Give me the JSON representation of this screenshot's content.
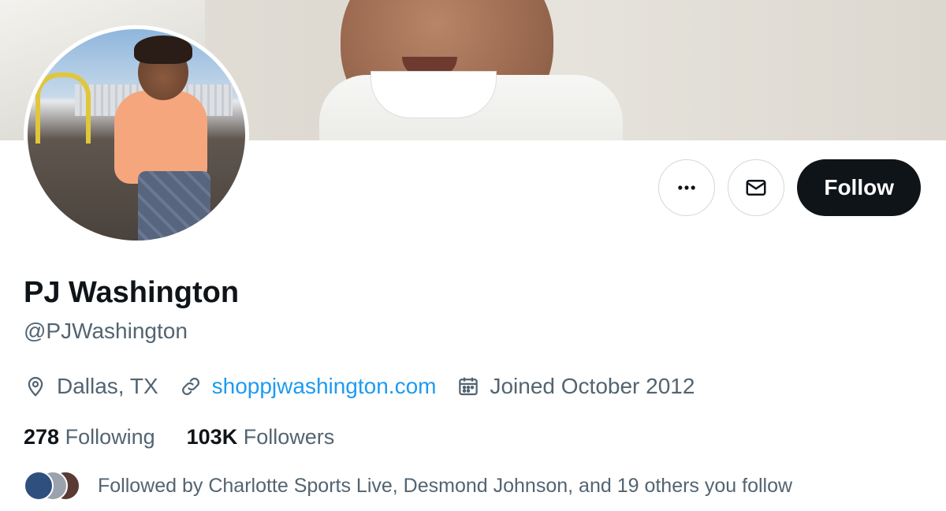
{
  "profile": {
    "name": "PJ Washington",
    "handle": "@PJWashington",
    "location": "Dallas, TX",
    "website": "shoppjwashington.com",
    "joined": "Joined October 2012"
  },
  "actions": {
    "more_icon": "more-horizontal-icon",
    "message_icon": "envelope-icon",
    "follow_label": "Follow"
  },
  "stats": {
    "following_count": "278",
    "following_label": "Following",
    "followers_count": "103K",
    "followers_label": "Followers"
  },
  "followed_by": {
    "text": "Followed by Charlotte Sports Live, Desmond Johnson, and 19 others you follow",
    "avatar_colors": [
      "#2f4f7f",
      "#9aa3ad",
      "#5a3a34"
    ]
  },
  "colors": {
    "accent": "#1d9bf0",
    "text_primary": "#0f1419",
    "text_secondary": "#536471",
    "button_dark": "#0f1419"
  }
}
